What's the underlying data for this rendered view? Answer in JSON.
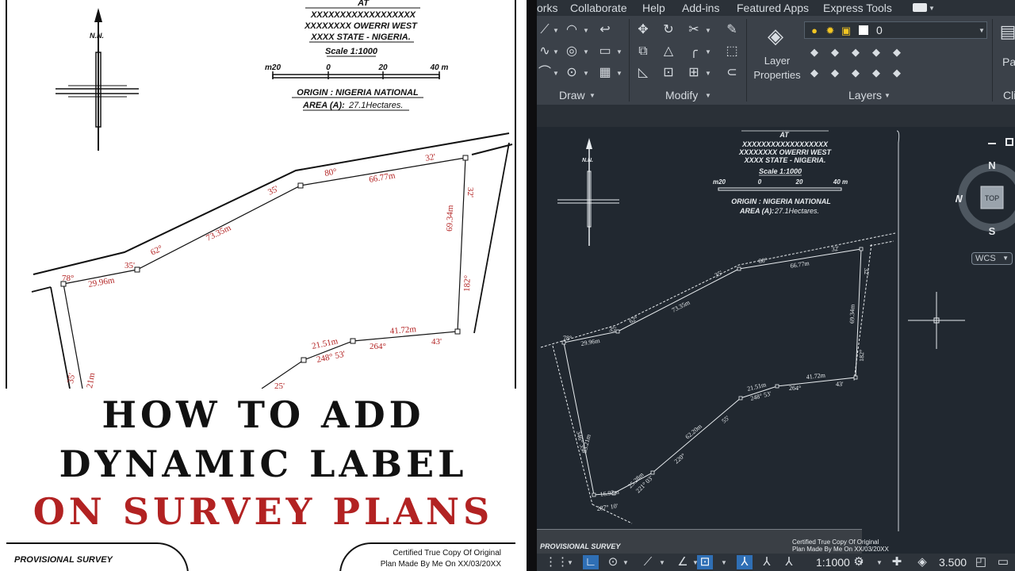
{
  "plan": {
    "north": "N.N.",
    "header_at": "AT",
    "header_line1": "XXXXXXXXXXXXXXXXXX",
    "header_line2": "XXXXXXXX OWERRI WEST",
    "header_line3": "XXXX STATE - NIGERIA.",
    "scale": "Scale  1:1000",
    "scale_ticks": [
      "m20",
      "0",
      "20",
      "40 m"
    ],
    "origin": "ORIGIN  : NIGERIA NATIONAL",
    "area_prefix": "AREA (A):",
    "area_value": "27.1Hectares.",
    "labels": {
      "b78": "78°",
      "d2996": "29.96m",
      "b35a": "35'",
      "b62": "62°",
      "d7335": "73.35m",
      "b35b": "35'",
      "b80": "80°",
      "d6677": "66.77m",
      "b32a": "32'",
      "b32b": "32'",
      "d6934": "69.34m",
      "b182": "182°",
      "b43": "43'",
      "d4172": "41.72m",
      "b264": "264°",
      "d2151": "21.51m",
      "b24853": "248° 53'",
      "b35c": "35'",
      "b21m": "21m",
      "b25": "25'"
    }
  },
  "cad_extra_labels": {
    "b34635": "346° 35'",
    "d8321": "83.21m",
    "d6220": "62.20m",
    "b55": "55'",
    "b220": "220°",
    "d2528": "25.28m",
    "b22103": "221° 03'",
    "d1693": "16.93m",
    "b28710": "287° 10'"
  },
  "title": {
    "line1": "HOW TO ADD",
    "line2": "DYNAMIC LABEL",
    "line3": "ON SURVEY PLANS"
  },
  "footer": {
    "provisional": "PROVISIONAL SURVEY",
    "certified_line1": "Certified  True  Copy Of  Original",
    "certified_line2": "Plan Made By Me On XX/03/20XX"
  },
  "cad": {
    "menu": [
      "orks",
      "Collaborate",
      "Help",
      "Add-ins",
      "Featured Apps",
      "Express Tools"
    ],
    "panels": {
      "draw": "Draw",
      "modify": "Modify",
      "layers": "Layers",
      "clip": "Cli",
      "paste": "Pas"
    },
    "layer_properties_line1": "Layer",
    "layer_properties_line2": "Properties",
    "current_layer": "0",
    "viewcube": {
      "n": "N",
      "s": "S",
      "w": "W",
      "top": "TOP"
    },
    "wcs": "WCS",
    "status": {
      "scale": "1:1000",
      "lineweight": "3.500"
    },
    "footer_provisional": "PROVISIONAL SURVEY",
    "footer_cert1": "Certified  True  Copy  Of  Original",
    "footer_cert2": "Plan Made By Me On XX/03/20XX"
  }
}
